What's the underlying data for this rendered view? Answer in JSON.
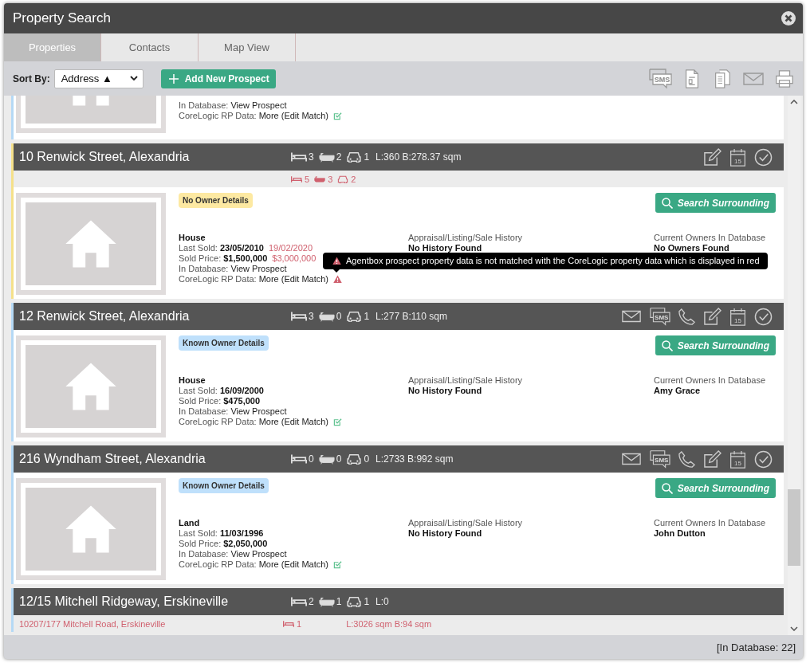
{
  "window": {
    "title": "Property Search"
  },
  "tabs": [
    {
      "label": "Properties",
      "selected": true
    },
    {
      "label": "Contacts",
      "selected": false
    },
    {
      "label": "Map View",
      "selected": false
    }
  ],
  "toolbar": {
    "sort_label": "Sort By:",
    "sort_value": "Address ▲",
    "add_button": "Add New Prospect",
    "icons": [
      {
        "kind": "sms",
        "label": "SMS"
      },
      {
        "kind": "document"
      },
      {
        "kind": "copy"
      },
      {
        "kind": "email"
      },
      {
        "kind": "print"
      }
    ]
  },
  "properties": [
    {
      "kind": "partial",
      "known_owner": true,
      "lines": [
        {
          "kind": "link",
          "label": "In Database:",
          "value": "View Prospect"
        },
        {
          "kind": "match",
          "label": "CoreLogic RP Data:",
          "value": "More (Edit Match)",
          "matched": true
        }
      ]
    },
    {
      "kind": "full",
      "address": "10 Renwick Street, Alexandria",
      "beds": "3",
      "baths": "2",
      "cars": "1",
      "size": "L:360 B:278.37 sqm",
      "actions": [
        {
          "kind": "edit"
        },
        {
          "kind": "calendar",
          "label": "15"
        },
        {
          "kind": "check"
        }
      ],
      "corelogic": {
        "beds": "5",
        "baths": "3",
        "cars": "2"
      },
      "badge": {
        "label": "No Owner Details",
        "kind": "none"
      },
      "type": "House",
      "lines": [
        {
          "kind": "value",
          "label": "Last Sold:",
          "value": "23/05/2010",
          "alt": "19/02/2020"
        },
        {
          "kind": "value",
          "label": "Sold Price:",
          "value": "$1,500,000",
          "alt": "$3,000,000"
        },
        {
          "kind": "link",
          "label": "In Database:",
          "value": "View Prospect"
        },
        {
          "kind": "match",
          "label": "CoreLogic RP Data:",
          "value": "More (Edit Match)",
          "matched": false
        }
      ],
      "history_label": "Appraisal/Listing/Sale History",
      "history": "No History Found",
      "owners_label": "Current Owners In Database",
      "owners": "No Owners Found",
      "button": "Search Surrounding",
      "tooltip": "Agentbox prospect property data is not matched with the CoreLogic property data which is displayed in red"
    },
    {
      "kind": "full",
      "address": "12 Renwick Street, Alexandria",
      "beds": "3",
      "baths": "0",
      "cars": "1",
      "size": "L:277 B:110 sqm",
      "actions": [
        {
          "kind": "email"
        },
        {
          "kind": "sms",
          "label": "SMS"
        },
        {
          "kind": "phone"
        },
        {
          "kind": "edit"
        },
        {
          "kind": "calendar",
          "label": "15"
        },
        {
          "kind": "check"
        }
      ],
      "badge": {
        "label": "Known Owner Details",
        "kind": "known"
      },
      "type": "House",
      "lines": [
        {
          "kind": "value",
          "label": "Last Sold:",
          "value": "16/09/2000"
        },
        {
          "kind": "value",
          "label": "Sold Price:",
          "value": "$475,000"
        },
        {
          "kind": "link",
          "label": "In Database:",
          "value": "View Prospect"
        },
        {
          "kind": "match",
          "label": "CoreLogic RP Data:",
          "value": "More (Edit Match)",
          "matched": true
        }
      ],
      "history_label": "Appraisal/Listing/Sale History",
      "history": "No History Found",
      "owners_label": "Current Owners In Database",
      "owners": "Amy Grace",
      "button": "Search Surrounding"
    },
    {
      "kind": "full",
      "address": "216 Wyndham Street, Alexandria",
      "beds": "0",
      "baths": "0",
      "cars": "0",
      "size": "L:2733 B:992 sqm",
      "actions": [
        {
          "kind": "email"
        },
        {
          "kind": "sms",
          "label": "SMS"
        },
        {
          "kind": "phone"
        },
        {
          "kind": "edit"
        },
        {
          "kind": "calendar",
          "label": "15"
        },
        {
          "kind": "check"
        }
      ],
      "badge": {
        "label": "Known Owner Details",
        "kind": "known"
      },
      "type": "Land",
      "lines": [
        {
          "kind": "value",
          "label": "Last Sold:",
          "value": "11/03/1996"
        },
        {
          "kind": "value",
          "label": "Sold Price:",
          "value": "$2,050,000"
        },
        {
          "kind": "link",
          "label": "In Database:",
          "value": "View Prospect"
        },
        {
          "kind": "match",
          "label": "CoreLogic RP Data:",
          "value": "More (Edit Match)",
          "matched": true
        }
      ],
      "history_label": "Appraisal/Listing/Sale History",
      "history": "No History Found",
      "owners_label": "Current Owners In Database",
      "owners": "John Dutton",
      "button": "Search Surrounding"
    },
    {
      "kind": "collapsed",
      "known_owner": true,
      "address": "12/15 Mitchell Ridgeway, Erskineville",
      "beds": "2",
      "baths": "1",
      "cars": "1",
      "size": "L:0",
      "corelogic": {
        "address": "10207/177 Mitchell Road, Erskineville",
        "beds": "1",
        "size": "L:3026 sqm B:94 sqm"
      }
    }
  ],
  "status_bar": "[In Database: 22]"
}
